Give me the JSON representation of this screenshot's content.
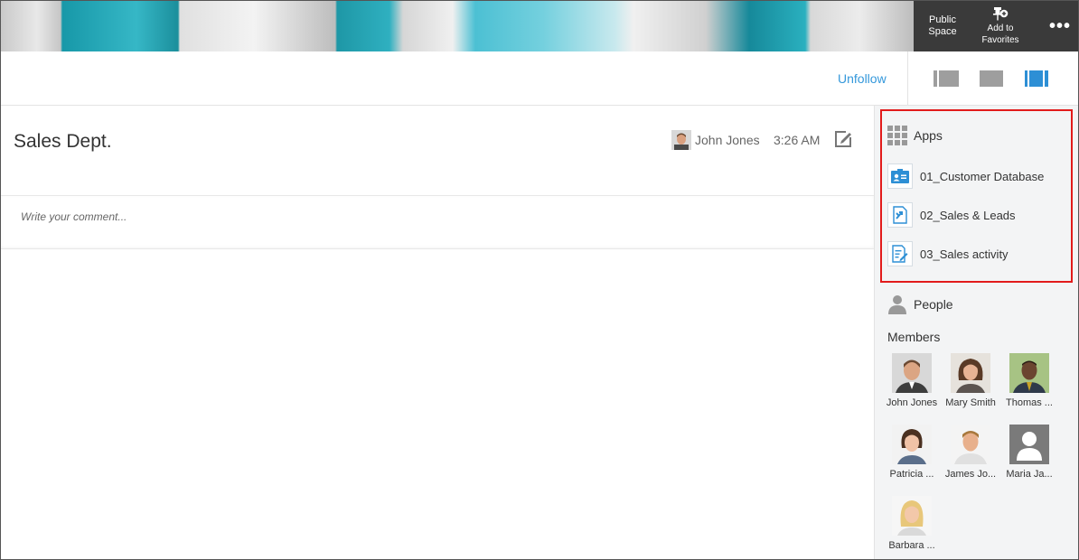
{
  "header": {
    "public_space": [
      "Public",
      "Space"
    ],
    "add_to_favorites": [
      "Add to",
      "Favorites"
    ],
    "more": "•••"
  },
  "toolbar": {
    "unfollow": "Unfollow"
  },
  "thread": {
    "title": "Sales Dept.",
    "author": "John Jones",
    "time": "3:26 AM",
    "comment_placeholder": "Write your comment..."
  },
  "sidebar": {
    "apps_title": "Apps",
    "apps": [
      {
        "label": "01_Customer Database",
        "icon": "customer-database-icon"
      },
      {
        "label": "02_Sales & Leads",
        "icon": "sales-leads-icon"
      },
      {
        "label": "03_Sales activity",
        "icon": "sales-activity-icon"
      }
    ],
    "people_title": "People",
    "members_title": "Members",
    "members": [
      {
        "name": "John Jones"
      },
      {
        "name": "Mary Smith"
      },
      {
        "name": "Thomas ..."
      },
      {
        "name": "Patricia ..."
      },
      {
        "name": "James Jo..."
      },
      {
        "name": "Maria Ja..."
      },
      {
        "name": "Barbara ..."
      }
    ]
  },
  "colors": {
    "accent": "#3498db",
    "highlight_box": "#e21b1b",
    "header_dark": "#3a3a3a"
  }
}
